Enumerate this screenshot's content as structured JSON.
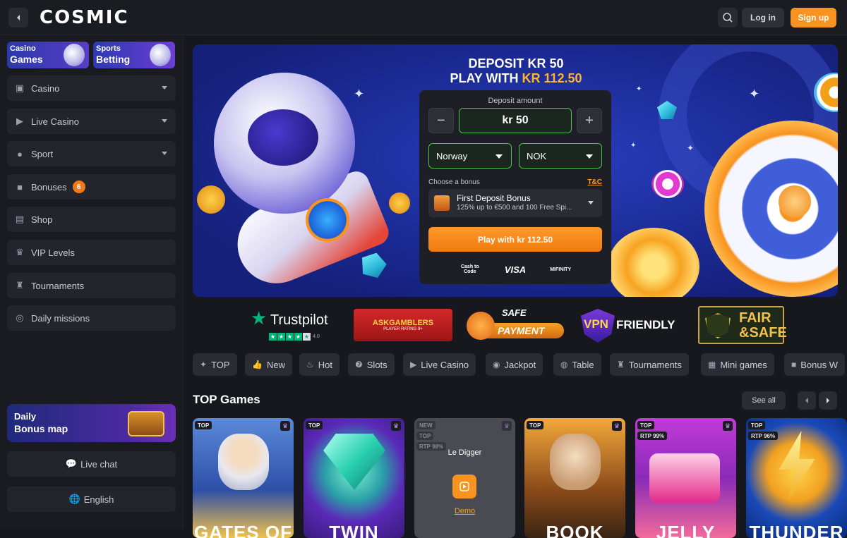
{
  "header": {
    "logo_text": "COSMIC",
    "search_icon": "search-icon",
    "login_label": "Log in",
    "signup_label": "Sign up"
  },
  "sidebar": {
    "category_cards": [
      {
        "line1": "Casino",
        "line2": "Games"
      },
      {
        "line1": "Sports",
        "line2": "Betting"
      }
    ],
    "items": [
      {
        "label": "Casino",
        "icon": "gamepad-icon",
        "expandable": true
      },
      {
        "label": "Live Casino",
        "icon": "play-icon",
        "expandable": true
      },
      {
        "label": "Sport",
        "icon": "ball-icon",
        "expandable": true
      },
      {
        "label": "Bonuses",
        "icon": "gift-icon",
        "badge": "6"
      },
      {
        "label": "Shop",
        "icon": "shop-icon"
      },
      {
        "label": "VIP Levels",
        "icon": "crown-icon"
      },
      {
        "label": "Tournaments",
        "icon": "trophy-icon"
      },
      {
        "label": "Daily missions",
        "icon": "target-icon"
      }
    ],
    "daily_card": {
      "line1": "Daily",
      "line2": "Bonus map"
    },
    "live_chat_label": "Live chat",
    "language_label": "English"
  },
  "hero": {
    "title_line1": "DEPOSIT KR 50",
    "title_line2_prefix": "PLAY WITH ",
    "title_line2_highlight": "KR 112.50",
    "deposit": {
      "amount_label": "Deposit amount",
      "amount_value": "kr 50",
      "minus": "−",
      "plus": "+",
      "country": "Norway",
      "currency": "NOK",
      "choose_bonus_label": "Choose a bonus",
      "tc_label": "T&C",
      "bonus_title": "First Deposit Bonus",
      "bonus_desc": "125% up to €500 and 100 Free Spi...",
      "play_button": "Play with kr 112.50",
      "payment_logos": [
        "Cash to Code",
        "VISA",
        "MIFINITY"
      ]
    }
  },
  "trust": {
    "trustpilot": "Trustpilot",
    "trustpilot_rating": "4.0",
    "askgamblers": "ASKGAMBLERS",
    "askgamblers_sub": "PLAYER RATING 9+",
    "safe_line1": "SAFE",
    "safe_line2": "PAYMENT",
    "vpn_word": "VPN",
    "vpn_friendly": "FRIENDLY",
    "fair_line1": "FAIR",
    "fair_line2": "&SAFE"
  },
  "tabs": [
    {
      "label": "TOP",
      "icon": "star-icon"
    },
    {
      "label": "New",
      "icon": "thumbs-up-icon"
    },
    {
      "label": "Hot",
      "icon": "flame-icon"
    },
    {
      "label": "Slots",
      "icon": "seven-icon"
    },
    {
      "label": "Live Casino",
      "icon": "play-icon"
    },
    {
      "label": "Jackpot",
      "icon": "coin-icon"
    },
    {
      "label": "Table",
      "icon": "chip-icon"
    },
    {
      "label": "Tournaments",
      "icon": "trophy-icon"
    },
    {
      "label": "Mini games",
      "icon": "grid-icon"
    },
    {
      "label": "Bonus W",
      "icon": "gift-icon"
    }
  ],
  "games_section": {
    "title": "TOP Games",
    "see_all": "See all",
    "games": [
      {
        "title": "GATES OF",
        "tag": "TOP",
        "tag2": "",
        "crown": true
      },
      {
        "title": "TWIN",
        "tag": "TOP",
        "tag2": "",
        "crown": true
      },
      {
        "title": "Le Digger",
        "tag": "NEW",
        "tag2": "TOP",
        "tag3": "RTP 98%",
        "crown": true,
        "demo": "Demo"
      },
      {
        "title": "BOOK",
        "tag": "TOP",
        "tag2": "",
        "crown": true
      },
      {
        "title": "JELLY",
        "tag": "TOP",
        "tag2": "RTP 99%",
        "crown": true
      },
      {
        "title": "THUNDER",
        "tag": "TOP",
        "tag2": "RTP 96%",
        "crown": false
      }
    ]
  },
  "colors": {
    "accent": "#f7931e",
    "background": "#17181d",
    "panel": "#24252c",
    "success_border": "#4fbf4f",
    "trustpilot_green": "#00b67a"
  }
}
